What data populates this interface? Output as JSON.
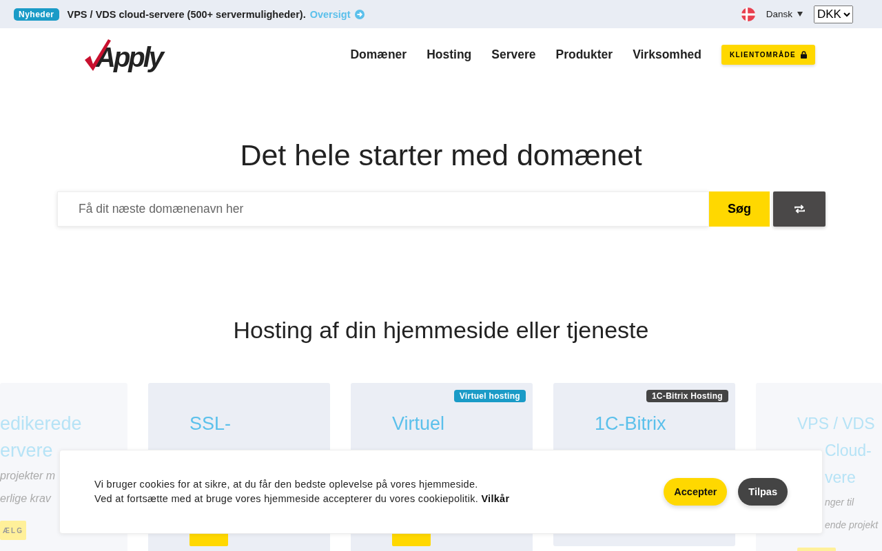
{
  "top_bar": {
    "badge": "Nyheder",
    "news": "VPS / VDS cloud-servere (500+ servermuligheder).",
    "news_link": "Oversigt",
    "language": "Dansk",
    "currency": "DKK"
  },
  "header": {
    "logo": "Apply",
    "nav": [
      "Domæner",
      "Hosting",
      "Servere",
      "Produkter",
      "Virksomhed"
    ],
    "client_button": "KLIENTOMRÅDE"
  },
  "hero": {
    "title": "Det hele starter med domænet",
    "search": {
      "placeholder": "Få dit næste domænenavn her",
      "button": "Søg"
    }
  },
  "hosting": {
    "title": "Hosting af din hjemmeside eller tjeneste",
    "cards": [
      {
        "active": false,
        "lines": [
          {
            "kind": "title",
            "text": "edikerede"
          },
          {
            "kind": "title",
            "text": "ervere"
          },
          {
            "kind": "text",
            "text": "projekter m"
          },
          {
            "kind": "text",
            "text": "erlige krav"
          }
        ],
        "button": "ÆLG"
      },
      {
        "active": true,
        "lines": [
          {
            "kind": "title",
            "text": "SSL-"
          }
        ],
        "button_visible": true
      },
      {
        "active": true,
        "badge": {
          "text": "Virtuel hosting",
          "color": "#1a9bc7"
        },
        "lines": [
          {
            "kind": "title",
            "text": "Virtuel"
          }
        ],
        "button_visible": true
      },
      {
        "active": true,
        "badge": {
          "text": "1C-Bitrix Hosting",
          "color": "#444444"
        },
        "lines": [
          {
            "kind": "title",
            "text": "1C-Bitrix"
          }
        ],
        "button_visible": false
      },
      {
        "active": false,
        "lines": [
          {
            "kind": "title",
            "text": "VPS / VDS"
          },
          {
            "kind": "title",
            "text": "Cloud-",
            "covered": true
          },
          {
            "kind": "title",
            "text": "vere",
            "covered": true
          },
          {
            "kind": "text",
            "text": "nger til",
            "covered": true
          },
          {
            "kind": "text",
            "text": "ende projekt",
            "covered": true
          }
        ],
        "button_visible": true
      }
    ]
  },
  "cookie_banner": {
    "line_1": "Vi bruger cookies for at sikre, at du får den bedste oplevelse på vores hjemmeside.",
    "line_2": "Ved at fortsætte med at bruge vores hjemmeside accepterer du vores cookiepolitik.",
    "link": "Vilkår",
    "accept": "Accepter",
    "customize": "Tilpas"
  }
}
